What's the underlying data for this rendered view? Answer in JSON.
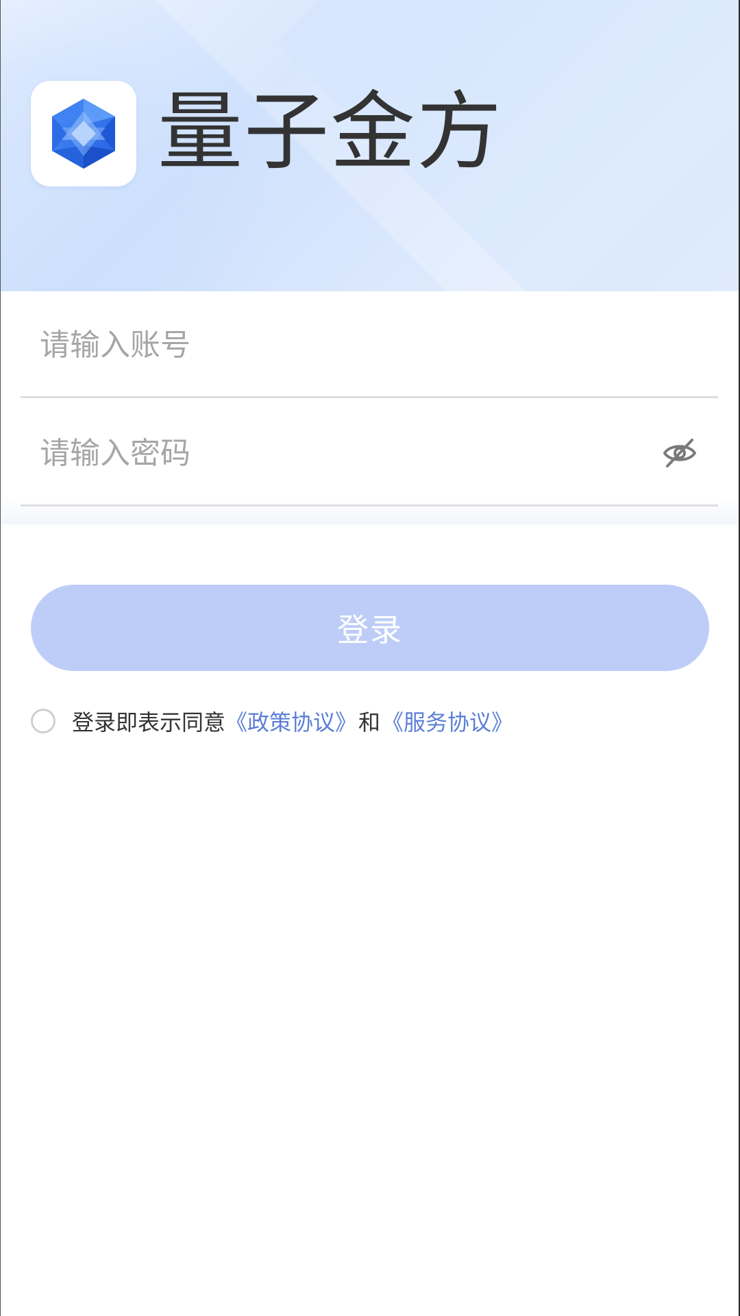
{
  "app": {
    "title": "量子金方",
    "logo_icon": "hexagon-gem-icon",
    "accent_color": "#2f6fe8"
  },
  "login_form": {
    "account_placeholder": "请输入账号",
    "account_value": "",
    "password_placeholder": "请输入密码",
    "password_value": "",
    "password_toggle_icon": "eye-off-icon",
    "submit_label": "登录",
    "submit_color": "#bdcdf7"
  },
  "agreement": {
    "checked": false,
    "prefix_text": "登录即表示同意",
    "policy_link": "《政策协议》",
    "and_text": "和",
    "service_link": "《服务协议》",
    "link_color": "#5b7fd6"
  }
}
